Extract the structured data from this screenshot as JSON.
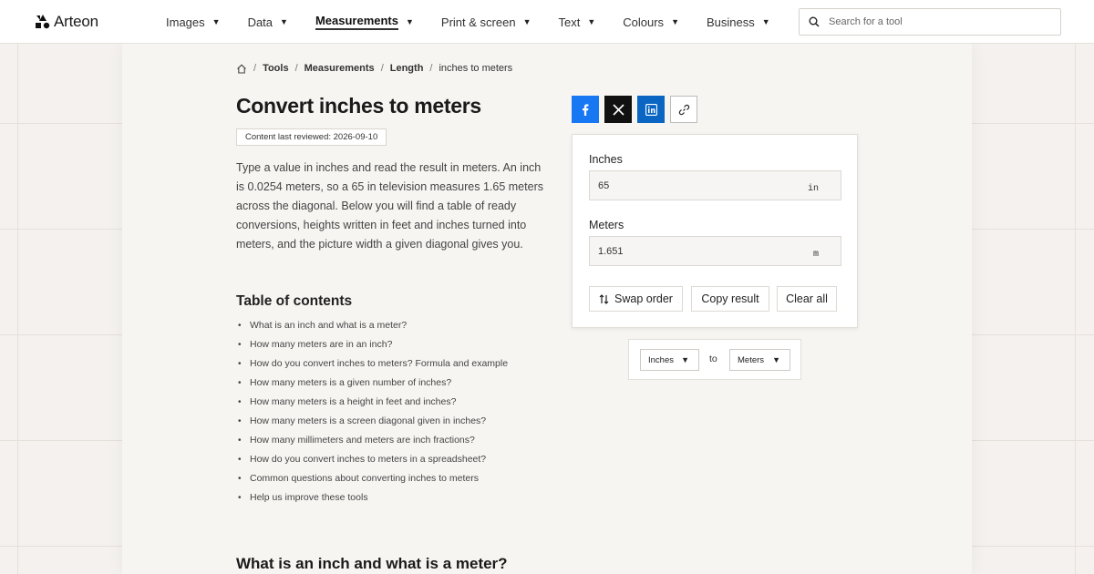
{
  "brand": {
    "name": "Arteon"
  },
  "nav": {
    "items": [
      {
        "label": "Images",
        "active": false
      },
      {
        "label": "Data",
        "active": false
      },
      {
        "label": "Measurements",
        "active": true
      },
      {
        "label": "Print & screen",
        "active": false
      },
      {
        "label": "Text",
        "active": false
      },
      {
        "label": "Colours",
        "active": false
      },
      {
        "label": "Business",
        "active": false
      }
    ],
    "caret": "▼"
  },
  "search": {
    "placeholder": "Search for a tool"
  },
  "breadcrumb": {
    "items": [
      "Tools",
      "Measurements",
      "Length"
    ],
    "current": "inches to meters",
    "separator": "/"
  },
  "page": {
    "title": "Convert inches to meters",
    "reviewed": "Content last reviewed: 2026-09-10",
    "intro": "Type a value in inches and read the result in meters. An inch is 0.0254 meters, so a 65 in television measures 1.65 meters across the diagonal. Below you will find a table of ready conversions, heights written in feet and inches turned into meters, and the picture width a given diagonal gives you."
  },
  "toc": {
    "title": "Table of contents",
    "items": [
      "What is an inch and what is a meter?",
      "How many meters are in an inch?",
      "How do you convert inches to meters? Formula and example",
      "How many meters is a given number of inches?",
      "How many meters is a height in feet and inches?",
      "How many meters is a screen diagonal given in inches?",
      "How many millimeters and meters are inch fractions?",
      "How do you convert inches to meters in a spreadsheet?",
      "Common questions about converting inches to meters",
      "Help us improve these tools"
    ]
  },
  "section": {
    "heading": "What is an inch and what is a meter?"
  },
  "converter": {
    "from_label": "Inches",
    "from_value": "65",
    "from_unit": "in",
    "to_label": "Meters",
    "to_value": "1.651",
    "to_unit": "m",
    "swap_label": "Swap order",
    "copy_label": "Copy result",
    "clear_label": "Clear all"
  },
  "unit_picker": {
    "from": "Inches",
    "connector": "to",
    "to": "Meters"
  },
  "colors": {
    "facebook": "#1877f2",
    "x": "#111111",
    "linkedin": "#0a66c2"
  }
}
